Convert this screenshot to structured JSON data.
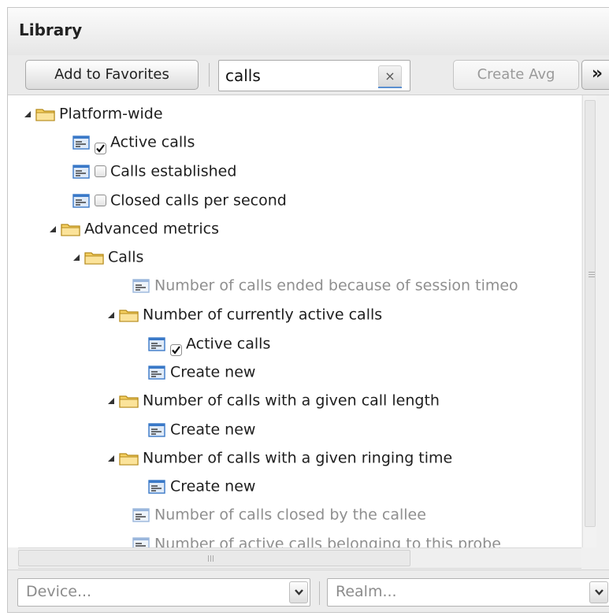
{
  "panel": {
    "title": "Library"
  },
  "toolbar": {
    "add_favorites_label": "Add to Favorites",
    "search_value": "calls",
    "clear_label": "×",
    "create_avg_label": "Create Avg",
    "more_label": "»"
  },
  "tree": {
    "nodes": [
      {
        "label": "Platform-wide",
        "kind": "folder",
        "expanded": true
      },
      {
        "label": "Active calls",
        "kind": "metric",
        "checked": true
      },
      {
        "label": "Calls established",
        "kind": "metric",
        "checked": false
      },
      {
        "label": "Closed calls per second",
        "kind": "metric",
        "checked": false
      },
      {
        "label": "Advanced metrics",
        "kind": "folder",
        "expanded": true
      },
      {
        "label": "Calls",
        "kind": "folder",
        "expanded": true
      },
      {
        "label": "Number of calls ended because of session timeo",
        "kind": "metric",
        "muted": true
      },
      {
        "label": "Number of currently active calls",
        "kind": "folder",
        "expanded": true
      },
      {
        "label": "Active calls",
        "kind": "metric",
        "checked": true
      },
      {
        "label": "Create new",
        "kind": "metric"
      },
      {
        "label": "Number of calls with a given call length",
        "kind": "folder",
        "expanded": true
      },
      {
        "label": "Create new",
        "kind": "metric"
      },
      {
        "label": "Number of calls with a given ringing time",
        "kind": "folder",
        "expanded": true
      },
      {
        "label": "Create new",
        "kind": "metric"
      },
      {
        "label": "Number of calls closed by the callee",
        "kind": "metric",
        "muted": true
      },
      {
        "label": "Number of active calls belonging to this probe",
        "kind": "metric",
        "muted": true
      }
    ]
  },
  "footer": {
    "device_placeholder": "Device...",
    "realm_placeholder": "Realm..."
  },
  "colors": {
    "folder_fill": "#f7d46a",
    "metric_icon_blue": "#3a79c8",
    "muted_text": "#8f8f8f"
  },
  "icons": {
    "folder": "folder-icon",
    "metric": "metric-icon",
    "expand": "expanded-triangle-icon",
    "dropdown": "chevron-down-icon"
  }
}
